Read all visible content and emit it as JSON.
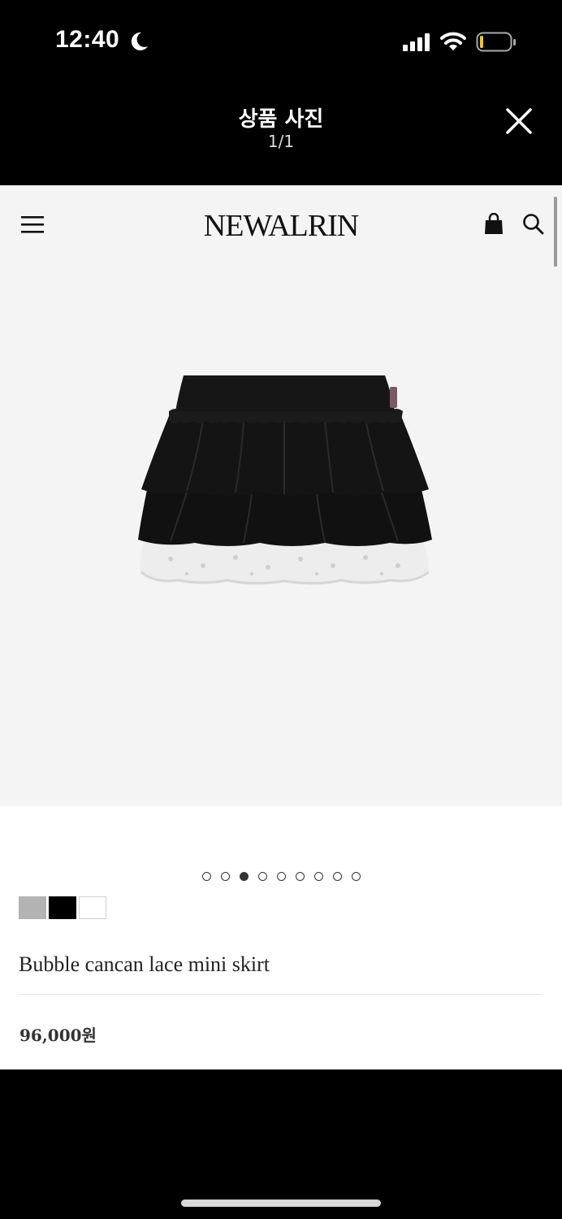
{
  "status_bar": {
    "time": "12:40",
    "icons": [
      "moon-icon",
      "cellular-signal-icon",
      "wifi-icon",
      "battery-icon"
    ]
  },
  "viewer": {
    "title": "상품 사진",
    "counter": "1/1",
    "close_icon": "close-icon"
  },
  "site": {
    "logo": "NEWALRIN",
    "icons": [
      "menu-icon",
      "shopping-bag-icon",
      "search-icon"
    ]
  },
  "product": {
    "image_alt": "skirt-photo",
    "carousel": {
      "count": 9,
      "active_index": 3
    },
    "swatches": [
      "#b3b3b3",
      "#000000",
      "#ffffff"
    ],
    "name": "Bubble cancan lace mini skirt",
    "price": "96,000원"
  },
  "colors": {
    "background": "#000000",
    "page": "#ffffff",
    "image_bg": "#f4f4f4"
  }
}
